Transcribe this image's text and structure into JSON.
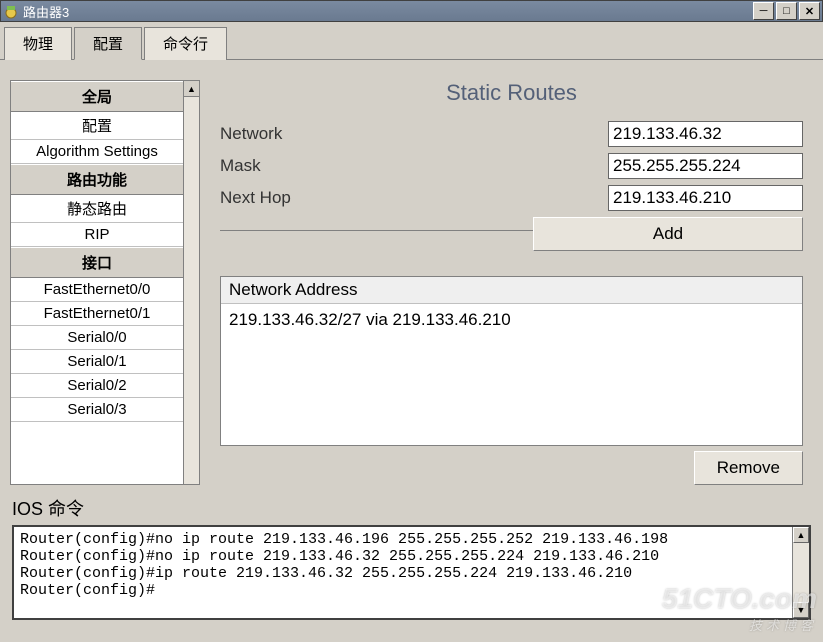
{
  "window": {
    "title": "路由器3"
  },
  "tabs": {
    "physical": "物理",
    "config": "配置",
    "cli": "命令行"
  },
  "sidebar": {
    "head_global": "全局",
    "item_settings": "配置",
    "item_algorithm": "Algorithm Settings",
    "head_routing": "路由功能",
    "item_static": "静态路由",
    "item_rip": "RIP",
    "head_iface": "接口",
    "item_fe00": "FastEthernet0/0",
    "item_fe01": "FastEthernet0/1",
    "item_s00": "Serial0/0",
    "item_s01": "Serial0/1",
    "item_s02": "Serial0/2",
    "item_s03": "Serial0/3"
  },
  "panel": {
    "title": "Static Routes",
    "label_network": "Network",
    "label_mask": "Mask",
    "label_nexthop": "Next Hop",
    "val_network": "219.133.46.32",
    "val_mask": "255.255.255.224",
    "val_nexthop": "219.133.46.210",
    "add": "Add",
    "na_head": "Network Address",
    "na_entry": "219.133.46.32/27 via 219.133.46.210",
    "remove": "Remove"
  },
  "ios": {
    "title": "IOS 命令",
    "lines": "Router(config)#no ip route 219.133.46.196 255.255.255.252 219.133.46.198\nRouter(config)#no ip route 219.133.46.32 255.255.255.224 219.133.46.210\nRouter(config)#ip route 219.133.46.32 255.255.255.224 219.133.46.210\nRouter(config)#"
  },
  "watermark": {
    "main": "51CTO.com",
    "sub": "技术博客"
  }
}
